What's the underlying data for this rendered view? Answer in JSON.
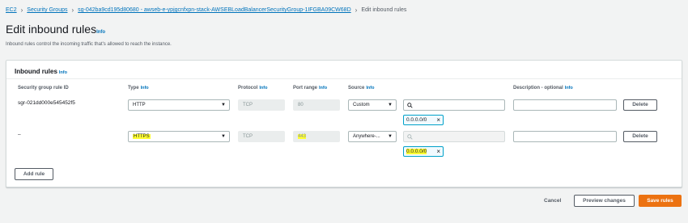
{
  "breadcrumb": {
    "ec2": "EC2",
    "security_groups": "Security Groups",
    "group": "sg-042ba9cd195d80680 - awseb-e-ypjgcnfxpn-stack-AWSEBLoadBalancerSecurityGroup-1IFGBA09CW68D",
    "current": "Edit inbound rules"
  },
  "page": {
    "title": "Edit inbound rules",
    "title_info": "Info",
    "description": "Inbound rules control the incoming traffic that's allowed to reach the instance."
  },
  "panel": {
    "title": "Inbound rules",
    "title_info": "Info"
  },
  "columns": {
    "rule_id": "Security group rule ID",
    "type": "Type",
    "type_info": "Info",
    "protocol": "Protocol",
    "protocol_info": "Info",
    "port_range": "Port range",
    "port_range_info": "Info",
    "source": "Source",
    "source_info": "Info",
    "description": "Description - optional",
    "description_info": "Info"
  },
  "rows": [
    {
      "rule_id": "sgr-021dd000e545452f5",
      "type": "HTTP",
      "protocol": "TCP",
      "port_range": "80",
      "source": "Custom",
      "search_value": "",
      "cidr": "0.0.0.0/0",
      "description": "",
      "delete_label": "Delete"
    },
    {
      "rule_id": "–",
      "type": "HTTPS",
      "protocol": "TCP",
      "port_range": "443",
      "source": "Anywhere-...",
      "search_value": "",
      "cidr": "0.0.0.0/0",
      "description": "",
      "delete_label": "Delete"
    }
  ],
  "add_rule_label": "Add rule",
  "footer": {
    "cancel": "Cancel",
    "preview": "Preview changes",
    "save": "Save rules"
  },
  "colors": {
    "link": "#0073bb",
    "highlight": "#ffff33",
    "primary": "#ec7211"
  }
}
